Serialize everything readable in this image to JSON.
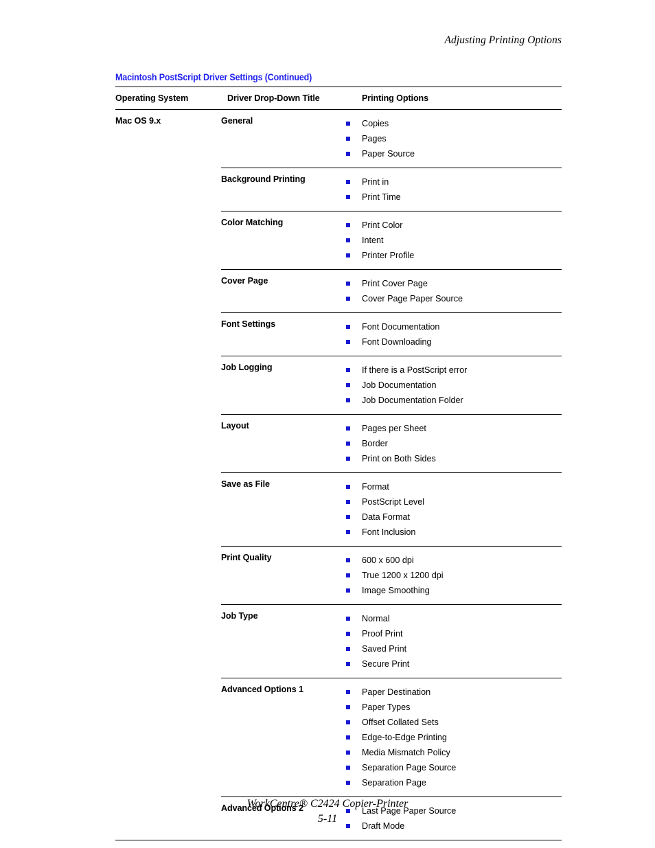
{
  "running_head": "Adjusting Printing Options",
  "table": {
    "caption": "Macintosh PostScript Driver Settings (Continued)",
    "columns": {
      "operating_system": "Operating System",
      "driver_drop_down_title": "Driver Drop-Down Title",
      "printing_options": "Printing Options"
    },
    "operating_system": "Mac OS 9.x",
    "groups": [
      {
        "title": "General",
        "options": [
          "Copies",
          "Pages",
          "Paper Source"
        ]
      },
      {
        "title": "Background Printing",
        "options": [
          "Print in",
          "Print Time"
        ]
      },
      {
        "title": "Color Matching",
        "options": [
          "Print Color",
          "Intent",
          "Printer Profile"
        ]
      },
      {
        "title": "Cover Page",
        "options": [
          "Print Cover Page",
          "Cover Page Paper Source"
        ]
      },
      {
        "title": "Font Settings",
        "options": [
          "Font Documentation",
          "Font Downloading"
        ]
      },
      {
        "title": "Job Logging",
        "options": [
          "If there is a PostScript error",
          "Job Documentation",
          "Job Documentation Folder"
        ]
      },
      {
        "title": "Layout",
        "options": [
          "Pages per Sheet",
          "Border",
          "Print on Both Sides"
        ]
      },
      {
        "title": "Save as File",
        "options": [
          "Format",
          "PostScript Level",
          "Data Format",
          "Font Inclusion"
        ]
      },
      {
        "title": "Print Quality",
        "options": [
          "600 x 600 dpi",
          "True 1200 x 1200 dpi",
          "Image Smoothing"
        ]
      },
      {
        "title": "Job Type",
        "options": [
          "Normal",
          "Proof Print",
          "Saved Print",
          "Secure Print"
        ]
      },
      {
        "title": "Advanced Options 1",
        "options": [
          "Paper Destination",
          "Paper Types",
          "Offset Collated Sets",
          "Edge-to-Edge Printing",
          "Media Mismatch Policy",
          "Separation Page Source",
          "Separation Page"
        ]
      },
      {
        "title": "Advanced Options 2",
        "options": [
          "Last Page Paper Source",
          "Draft Mode"
        ]
      }
    ]
  },
  "footer": {
    "product": "WorkCentre® C2424 Copier-Printer",
    "page_number": "5-11"
  },
  "colors": {
    "caption_blue": "#2222ee",
    "bullet_blue": "#1a1ad0",
    "rule_black": "#000000"
  }
}
